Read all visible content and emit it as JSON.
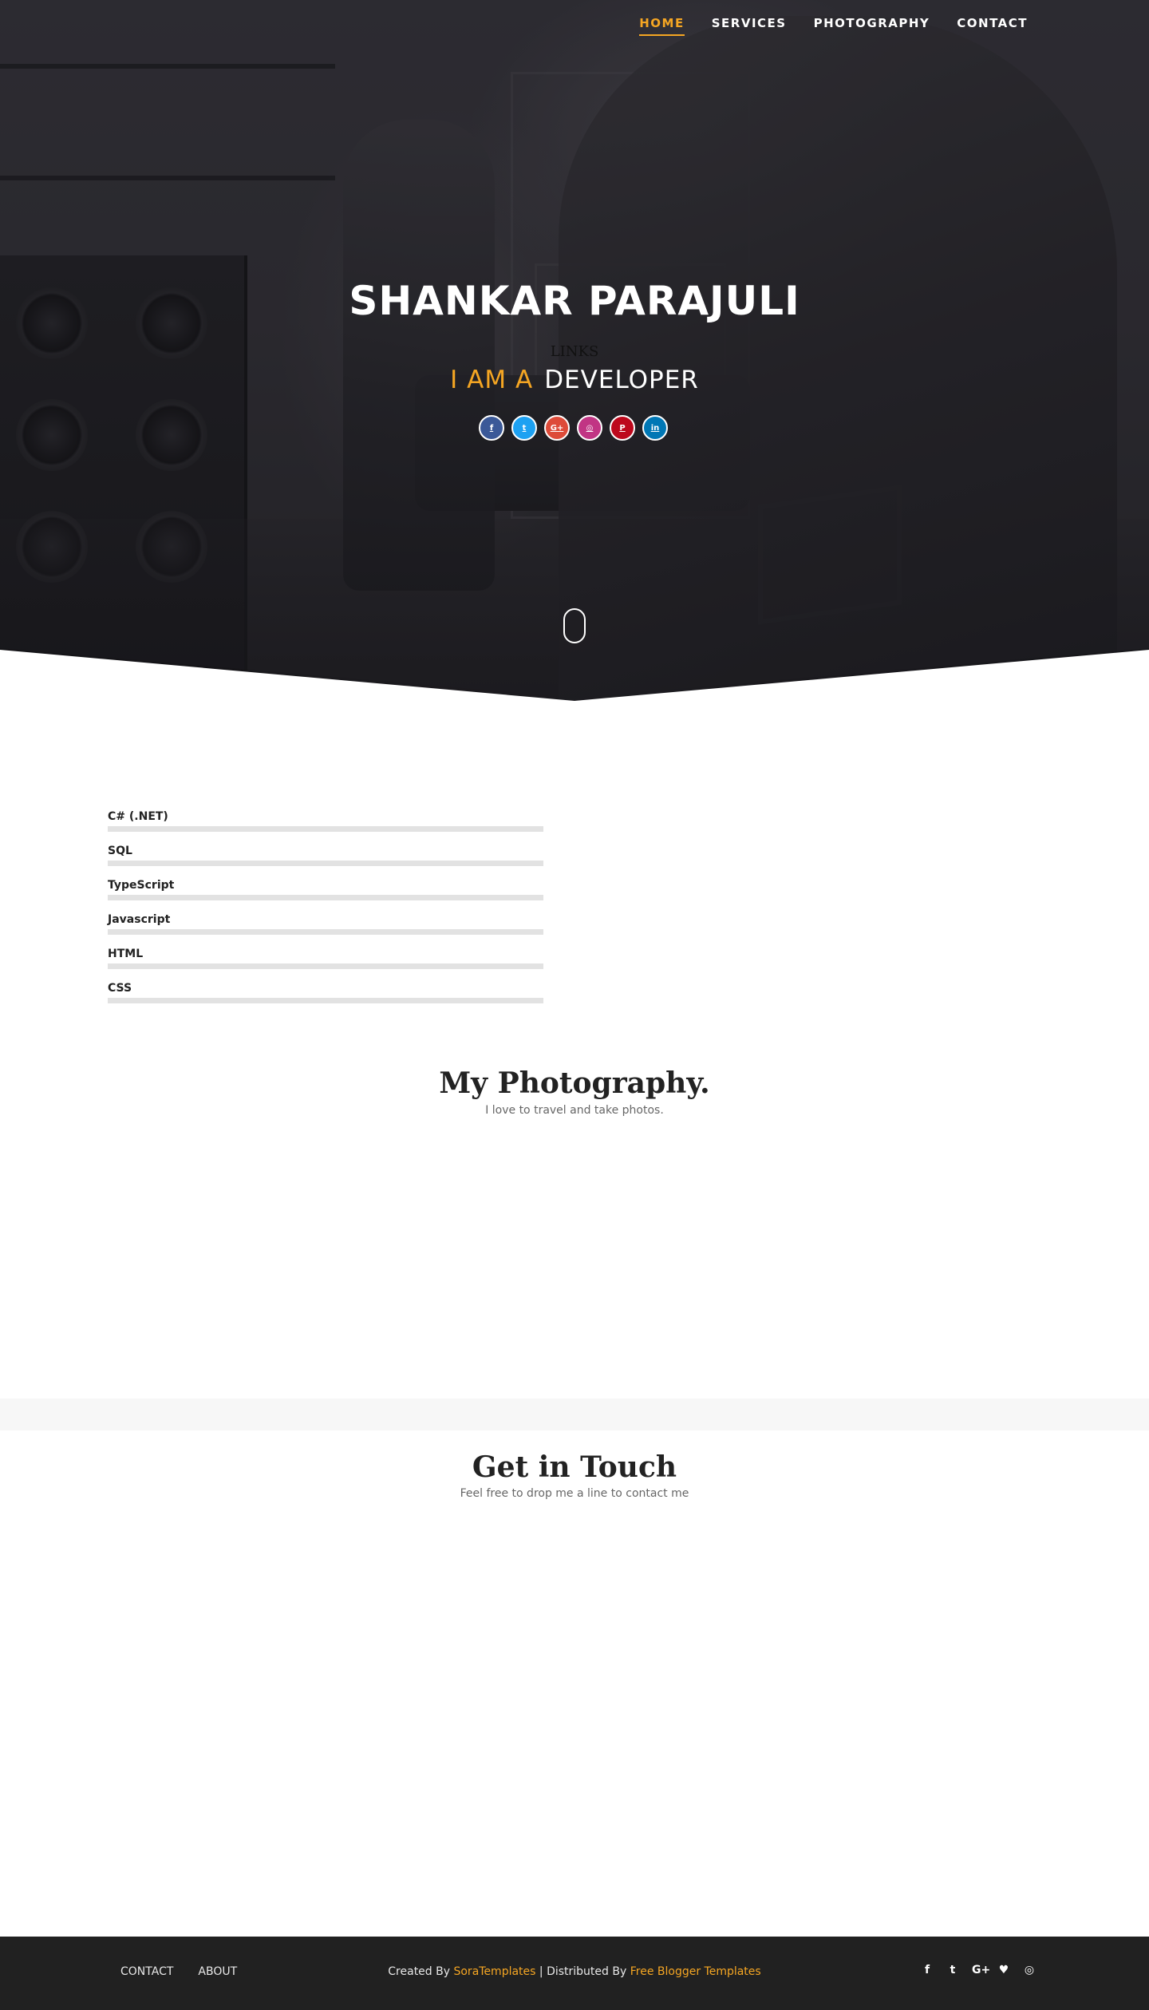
{
  "nav": {
    "items": [
      {
        "label": "HOME",
        "active": true
      },
      {
        "label": "SERVICES",
        "active": false
      },
      {
        "label": "PHOTOGRAPHY",
        "active": false
      },
      {
        "label": "CONTACT",
        "active": false
      }
    ]
  },
  "hero": {
    "title": "SHANKAR PARAJULI",
    "links_label": "LINKS",
    "subtitle_prefix": "I AM A",
    "subtitle_role": "DEVELOPER",
    "socials": [
      {
        "icon": "facebook-icon",
        "glyph": "f",
        "color": "#3b5998"
      },
      {
        "icon": "twitter-icon",
        "glyph": "t",
        "color": "#1da1f2"
      },
      {
        "icon": "google-plus-icon",
        "glyph": "G+",
        "color": "#dd4b39"
      },
      {
        "icon": "instagram-icon",
        "glyph": "◎",
        "color": "#c13584"
      },
      {
        "icon": "pinterest-icon",
        "glyph": "P",
        "color": "#bd081c"
      },
      {
        "icon": "linkedin-icon",
        "glyph": "in",
        "color": "#0077b5"
      }
    ]
  },
  "skills": [
    {
      "label": "C# (.NET)",
      "level": 0
    },
    {
      "label": "SQL",
      "level": 0
    },
    {
      "label": "TypeScript",
      "level": 0
    },
    {
      "label": "Javascript",
      "level": 0
    },
    {
      "label": "HTML",
      "level": 0
    },
    {
      "label": "CSS",
      "level": 0
    }
  ],
  "photography": {
    "title": "My Photography.",
    "subtitle": "I love to travel and take photos."
  },
  "contact": {
    "title": "Get in Touch",
    "subtitle": "Feel free to drop me a line to contact me"
  },
  "footer": {
    "links": [
      "CONTACT",
      "ABOUT"
    ],
    "created_by_prefix": "Created By",
    "created_by_name": "SoraTemplates",
    "separator": "| Distributed By",
    "distributed_by_name": "Free Blogger Templates",
    "socials": [
      {
        "icon": "facebook-icon",
        "glyph": "f"
      },
      {
        "icon": "twitter-icon",
        "glyph": "t"
      },
      {
        "icon": "google-plus-icon",
        "glyph": "G+"
      },
      {
        "icon": "heart-icon",
        "glyph": "♥"
      },
      {
        "icon": "instagram-icon",
        "glyph": "◎"
      }
    ]
  },
  "colors": {
    "accent": "#f5a623",
    "footer_bg": "#212121"
  }
}
